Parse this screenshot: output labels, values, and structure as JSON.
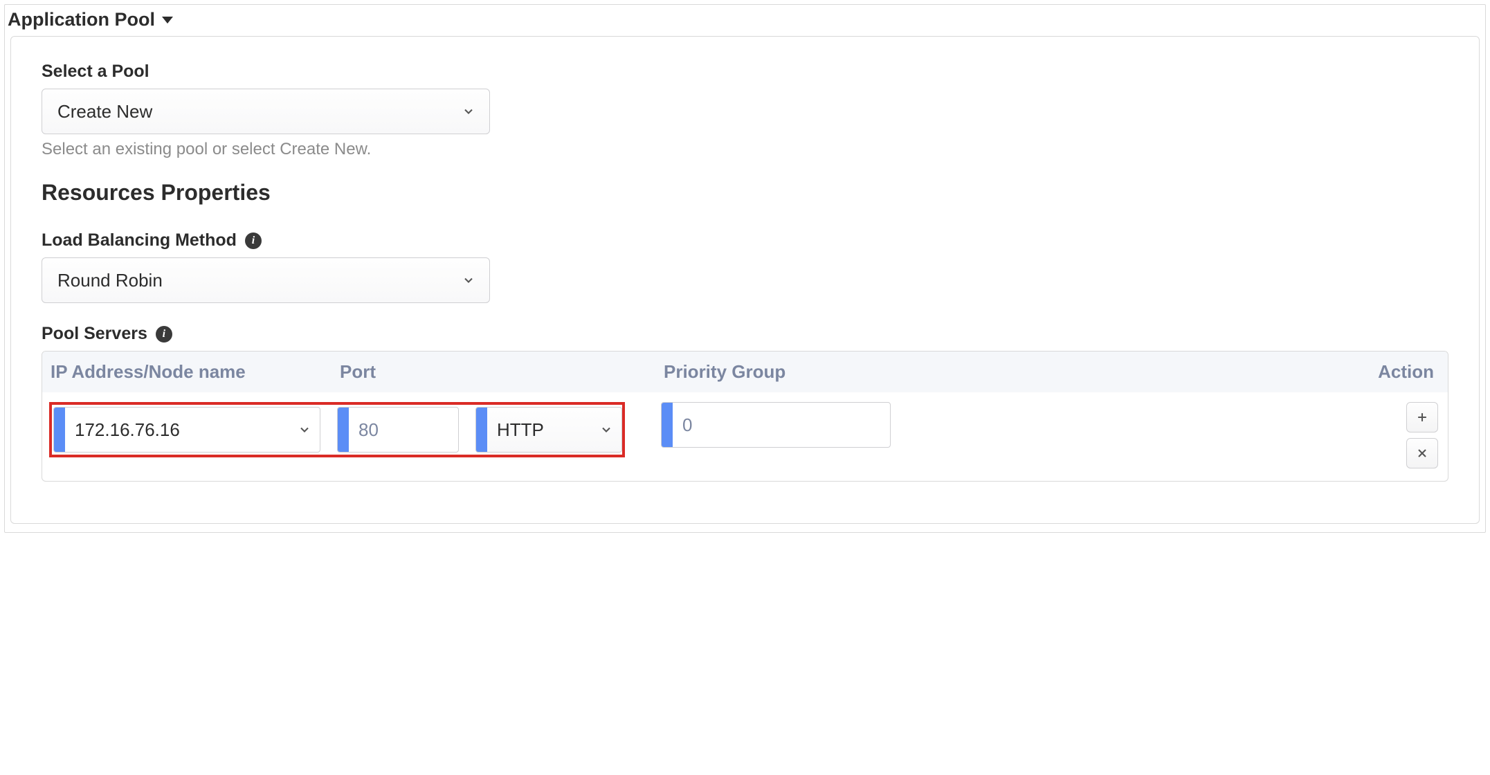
{
  "header": {
    "title": "Application Pool"
  },
  "pool": {
    "select_label": "Select a Pool",
    "select_value": "Create New",
    "help_text": "Select an existing pool or select Create New."
  },
  "section_title": "Resources Properties",
  "lb": {
    "label": "Load Balancing Method",
    "value": "Round Robin"
  },
  "servers": {
    "label": "Pool Servers",
    "columns": {
      "ip": "IP Address/Node name",
      "port": "Port",
      "priority": "Priority Group",
      "action": "Action"
    },
    "row": {
      "ip": "172.16.76.16",
      "port": "80",
      "protocol": "HTTP",
      "priority": "0"
    }
  }
}
